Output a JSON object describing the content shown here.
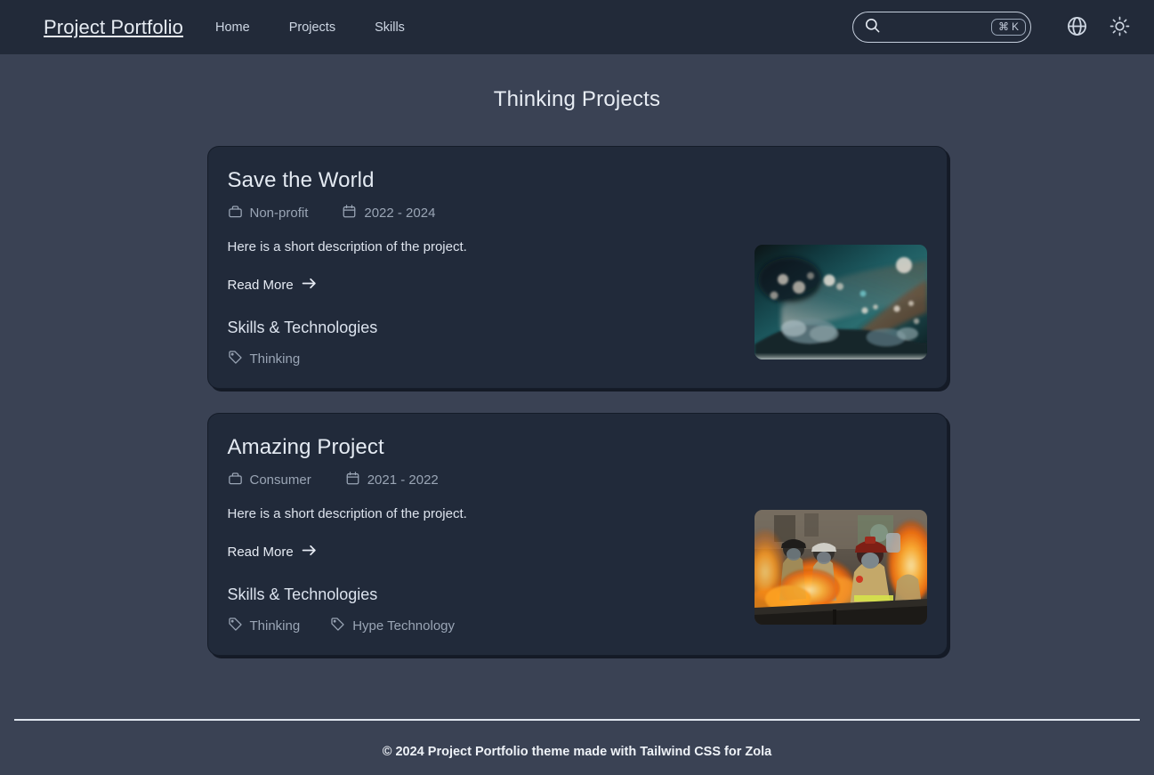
{
  "header": {
    "brand": "Project Portfolio",
    "nav": [
      {
        "label": "Home"
      },
      {
        "label": "Projects"
      },
      {
        "label": "Skills"
      }
    ],
    "search": {
      "value": "",
      "placeholder": "",
      "shortcut_symbol": "⌘",
      "shortcut_key": "K",
      "icon": "search-icon"
    },
    "language_icon": "globe-icon",
    "theme_icon": "sun-icon"
  },
  "main": {
    "title": "Thinking Projects",
    "skills_heading": "Skills & Technologies",
    "read_more_label": "Read More",
    "projects": [
      {
        "title": "Save the World",
        "category": "Non-profit",
        "category_icon": "briefcase-icon",
        "dates": "2022 - 2024",
        "dates_icon": "calendar-icon",
        "description": "Here is a short description of the project.",
        "read_more": "Read More",
        "skills_heading": "Skills & Technologies",
        "tags": [
          "Thinking"
        ],
        "image_alt": "abstract teal water bokeh"
      },
      {
        "title": "Amazing Project",
        "category": "Consumer",
        "category_icon": "briefcase-icon",
        "dates": "2021 - 2022",
        "dates_icon": "calendar-icon",
        "description": "Here is a short description of the project.",
        "read_more": "Read More",
        "skills_heading": "Skills & Technologies",
        "tags": [
          "Thinking",
          "Hype Technology"
        ],
        "image_alt": "firefighters with flames"
      }
    ]
  },
  "footer": {
    "text": "© 2024 Project Portfolio theme made with Tailwind CSS for Zola"
  },
  "colors": {
    "navbar_bg": "#222a39",
    "page_bg": "#3a4254",
    "card_bg": "#212a3a",
    "card_shadow": "#141a26",
    "text_primary": "#e4eaf2",
    "text_muted": "#9aa5b5",
    "divider": "#dfe5ee"
  }
}
